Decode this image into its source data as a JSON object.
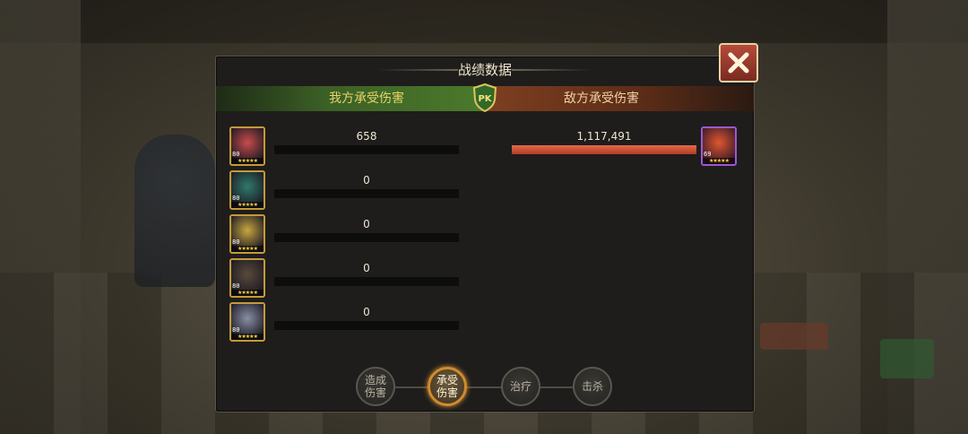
{
  "title": "战绩数据",
  "header": {
    "left_label": "我方承受伤害",
    "right_label": "敌方承受伤害",
    "pk_badge": "PK"
  },
  "our_team": [
    {
      "level": "80",
      "stars": "★★★★★",
      "value": "658",
      "icon": "hero-red-hair-portrait",
      "fill": 0.0006
    },
    {
      "level": "80",
      "stars": "★★★★★",
      "value": "0",
      "icon": "hero-green-medusa-portrait",
      "fill": 0
    },
    {
      "level": "80",
      "stars": "★★★★★",
      "value": "0",
      "icon": "hero-blonde-portrait",
      "fill": 0
    },
    {
      "level": "80",
      "stars": "★★★★★",
      "value": "0",
      "icon": "hero-masked-dark-portrait",
      "fill": 0
    },
    {
      "level": "80",
      "stars": "★★★★★",
      "value": "0",
      "icon": "hero-silver-hair-portrait",
      "fill": 0
    }
  ],
  "enemy_team": [
    {
      "level": "69",
      "stars": "★★★★★",
      "value": "1,117,491",
      "icon": "enemy-red-beast-portrait",
      "fill": 1.0
    }
  ],
  "tabs": [
    {
      "label_line1": "造成",
      "label_line2": "伤害",
      "active": false
    },
    {
      "label_line1": "承受",
      "label_line2": "伤害",
      "active": true
    },
    {
      "label_line1": "治疗",
      "label_line2": "",
      "active": false
    },
    {
      "label_line1": "击杀",
      "label_line2": "",
      "active": false
    }
  ],
  "close_icon": "close-x-icon",
  "colors": {
    "accent_gold": "#c49a3a",
    "enemy_bar": "#b33b24",
    "ally_header": "#4b7a2c",
    "enemy_header": "#7e3f20"
  }
}
